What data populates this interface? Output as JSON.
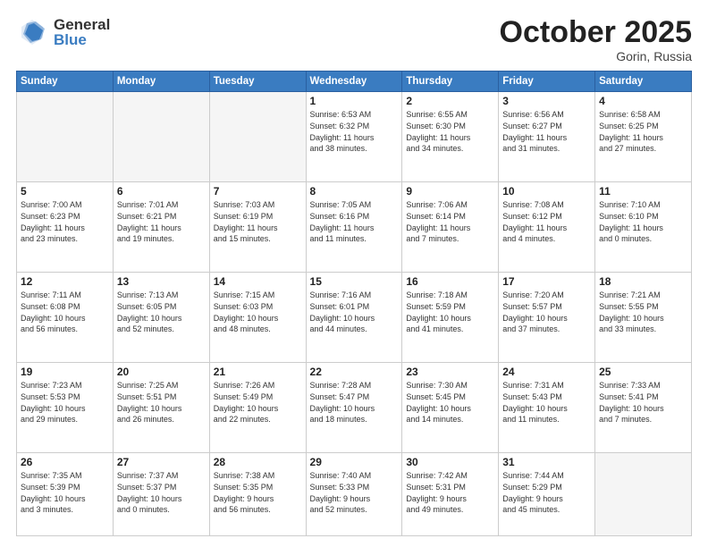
{
  "logo": {
    "general": "General",
    "blue": "Blue"
  },
  "header": {
    "month": "October 2025",
    "location": "Gorin, Russia"
  },
  "days_of_week": [
    "Sunday",
    "Monday",
    "Tuesday",
    "Wednesday",
    "Thursday",
    "Friday",
    "Saturday"
  ],
  "weeks": [
    [
      {
        "num": "",
        "info": ""
      },
      {
        "num": "",
        "info": ""
      },
      {
        "num": "",
        "info": ""
      },
      {
        "num": "1",
        "info": "Sunrise: 6:53 AM\nSunset: 6:32 PM\nDaylight: 11 hours\nand 38 minutes."
      },
      {
        "num": "2",
        "info": "Sunrise: 6:55 AM\nSunset: 6:30 PM\nDaylight: 11 hours\nand 34 minutes."
      },
      {
        "num": "3",
        "info": "Sunrise: 6:56 AM\nSunset: 6:27 PM\nDaylight: 11 hours\nand 31 minutes."
      },
      {
        "num": "4",
        "info": "Sunrise: 6:58 AM\nSunset: 6:25 PM\nDaylight: 11 hours\nand 27 minutes."
      }
    ],
    [
      {
        "num": "5",
        "info": "Sunrise: 7:00 AM\nSunset: 6:23 PM\nDaylight: 11 hours\nand 23 minutes."
      },
      {
        "num": "6",
        "info": "Sunrise: 7:01 AM\nSunset: 6:21 PM\nDaylight: 11 hours\nand 19 minutes."
      },
      {
        "num": "7",
        "info": "Sunrise: 7:03 AM\nSunset: 6:19 PM\nDaylight: 11 hours\nand 15 minutes."
      },
      {
        "num": "8",
        "info": "Sunrise: 7:05 AM\nSunset: 6:16 PM\nDaylight: 11 hours\nand 11 minutes."
      },
      {
        "num": "9",
        "info": "Sunrise: 7:06 AM\nSunset: 6:14 PM\nDaylight: 11 hours\nand 7 minutes."
      },
      {
        "num": "10",
        "info": "Sunrise: 7:08 AM\nSunset: 6:12 PM\nDaylight: 11 hours\nand 4 minutes."
      },
      {
        "num": "11",
        "info": "Sunrise: 7:10 AM\nSunset: 6:10 PM\nDaylight: 11 hours\nand 0 minutes."
      }
    ],
    [
      {
        "num": "12",
        "info": "Sunrise: 7:11 AM\nSunset: 6:08 PM\nDaylight: 10 hours\nand 56 minutes."
      },
      {
        "num": "13",
        "info": "Sunrise: 7:13 AM\nSunset: 6:05 PM\nDaylight: 10 hours\nand 52 minutes."
      },
      {
        "num": "14",
        "info": "Sunrise: 7:15 AM\nSunset: 6:03 PM\nDaylight: 10 hours\nand 48 minutes."
      },
      {
        "num": "15",
        "info": "Sunrise: 7:16 AM\nSunset: 6:01 PM\nDaylight: 10 hours\nand 44 minutes."
      },
      {
        "num": "16",
        "info": "Sunrise: 7:18 AM\nSunset: 5:59 PM\nDaylight: 10 hours\nand 41 minutes."
      },
      {
        "num": "17",
        "info": "Sunrise: 7:20 AM\nSunset: 5:57 PM\nDaylight: 10 hours\nand 37 minutes."
      },
      {
        "num": "18",
        "info": "Sunrise: 7:21 AM\nSunset: 5:55 PM\nDaylight: 10 hours\nand 33 minutes."
      }
    ],
    [
      {
        "num": "19",
        "info": "Sunrise: 7:23 AM\nSunset: 5:53 PM\nDaylight: 10 hours\nand 29 minutes."
      },
      {
        "num": "20",
        "info": "Sunrise: 7:25 AM\nSunset: 5:51 PM\nDaylight: 10 hours\nand 26 minutes."
      },
      {
        "num": "21",
        "info": "Sunrise: 7:26 AM\nSunset: 5:49 PM\nDaylight: 10 hours\nand 22 minutes."
      },
      {
        "num": "22",
        "info": "Sunrise: 7:28 AM\nSunset: 5:47 PM\nDaylight: 10 hours\nand 18 minutes."
      },
      {
        "num": "23",
        "info": "Sunrise: 7:30 AM\nSunset: 5:45 PM\nDaylight: 10 hours\nand 14 minutes."
      },
      {
        "num": "24",
        "info": "Sunrise: 7:31 AM\nSunset: 5:43 PM\nDaylight: 10 hours\nand 11 minutes."
      },
      {
        "num": "25",
        "info": "Sunrise: 7:33 AM\nSunset: 5:41 PM\nDaylight: 10 hours\nand 7 minutes."
      }
    ],
    [
      {
        "num": "26",
        "info": "Sunrise: 7:35 AM\nSunset: 5:39 PM\nDaylight: 10 hours\nand 3 minutes."
      },
      {
        "num": "27",
        "info": "Sunrise: 7:37 AM\nSunset: 5:37 PM\nDaylight: 10 hours\nand 0 minutes."
      },
      {
        "num": "28",
        "info": "Sunrise: 7:38 AM\nSunset: 5:35 PM\nDaylight: 9 hours\nand 56 minutes."
      },
      {
        "num": "29",
        "info": "Sunrise: 7:40 AM\nSunset: 5:33 PM\nDaylight: 9 hours\nand 52 minutes."
      },
      {
        "num": "30",
        "info": "Sunrise: 7:42 AM\nSunset: 5:31 PM\nDaylight: 9 hours\nand 49 minutes."
      },
      {
        "num": "31",
        "info": "Sunrise: 7:44 AM\nSunset: 5:29 PM\nDaylight: 9 hours\nand 45 minutes."
      },
      {
        "num": "",
        "info": ""
      }
    ]
  ]
}
